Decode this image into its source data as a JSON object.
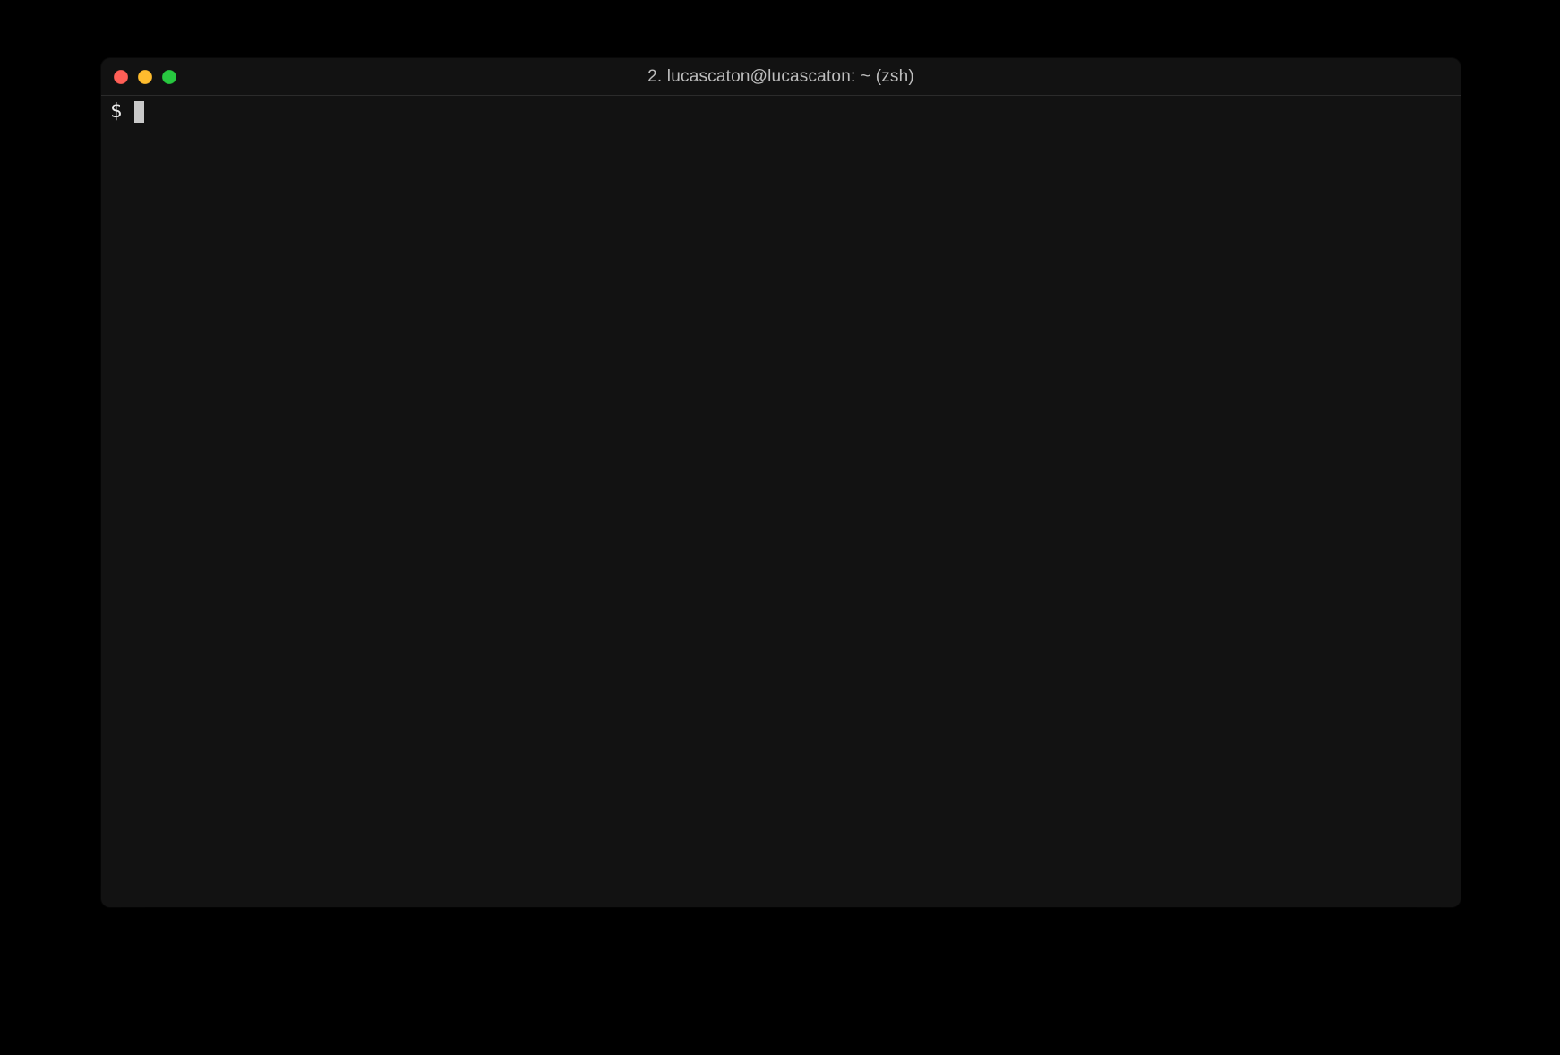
{
  "window": {
    "title": "2. lucascaton@lucascaton: ~ (zsh)"
  },
  "terminal": {
    "prompt": "$",
    "input": ""
  }
}
